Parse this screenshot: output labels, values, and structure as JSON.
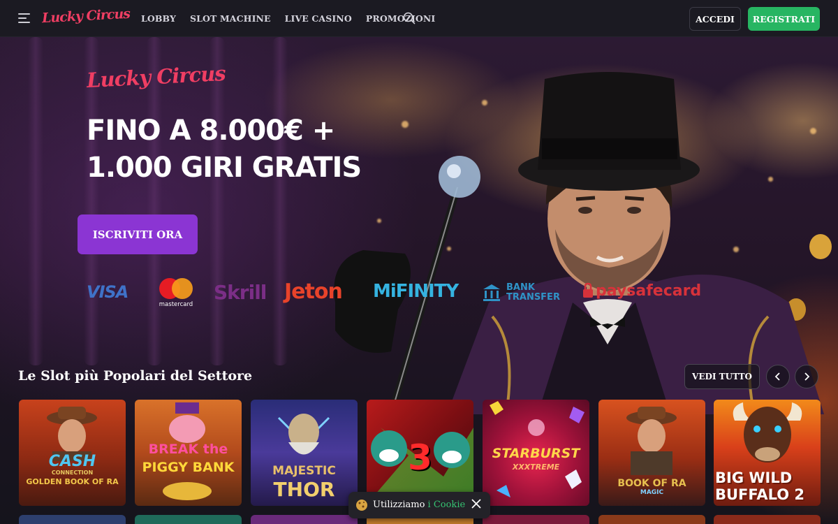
{
  "header": {
    "logo": "Lucky Circus",
    "nav": [
      "LOBBY",
      "SLOT MACHINE",
      "LIVE CASINO",
      "PROMOZIONI"
    ],
    "login_label": "ACCEDI",
    "register_label": "REGISTRATI"
  },
  "hero": {
    "logo": "Lucky Circus",
    "title_line1": "FINO A 8.000€ +",
    "title_line2": "1.000 GIRI GRATIS",
    "cta_label": "ISCRIVITI ORA",
    "payments": {
      "visa": "VISA",
      "mastercard": "mastercard",
      "skrill": "Skrill",
      "jeton": "Jeton",
      "mifinity": "MiFINITY",
      "bank_line1": "BANK",
      "bank_line2": "TRANSFER",
      "paysafecard": "paysafecard"
    }
  },
  "slots_section": {
    "title": "Le Slot più Popolari del Settore",
    "see_all_label": "VEDI TUTTO",
    "prev_icon": "chevron-left-icon",
    "next_icon": "chevron-right-icon",
    "games": [
      {
        "title": "CASH",
        "subtitle": "CONNECTION",
        "extra": "GOLDEN BOOK OF RA"
      },
      {
        "title": "BREAK the",
        "subtitle": "PIGGY BANK",
        "extra": ""
      },
      {
        "title": "MAJESTIC",
        "subtitle": "THOR",
        "extra": ""
      },
      {
        "title": "3",
        "subtitle": "",
        "extra": ""
      },
      {
        "title": "STARBURST",
        "subtitle": "XXXTREME",
        "extra": ""
      },
      {
        "title": "BOOK OF RA",
        "subtitle": "MAGIC",
        "extra": ""
      },
      {
        "title": "BIG WILD",
        "subtitle": "BUFFALO 2",
        "extra": ""
      }
    ]
  },
  "cookie": {
    "text": "Utilizziamo ",
    "link": "i Cookie"
  },
  "colors": {
    "brand": "#f03e63",
    "register_green": "#27b562",
    "cta_purple": "#8b35d3",
    "cookie_link": "#36c372"
  }
}
